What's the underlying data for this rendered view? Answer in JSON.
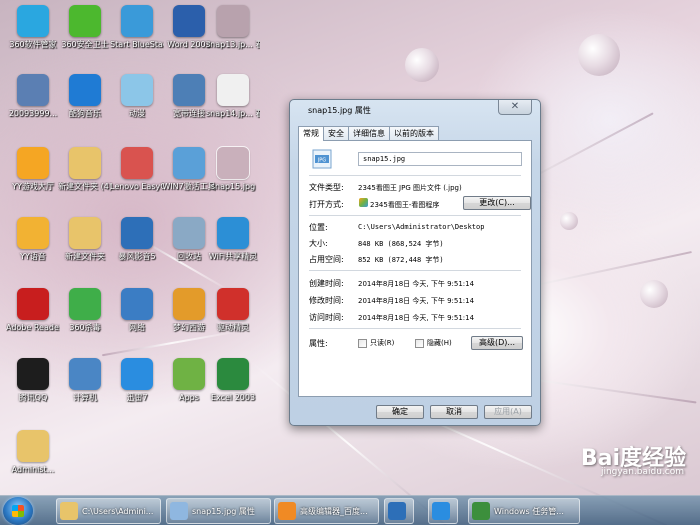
{
  "desktop": {
    "icons": [
      {
        "label": "360软件管家",
        "icon": "360-software-manager-icon",
        "color": "#2aa7e0"
      },
      {
        "label": "360安全卫士",
        "icon": "360-security-icon",
        "color": "#4cb82e"
      },
      {
        "label": "Start BlueStacks",
        "icon": "bluestacks-icon",
        "color": "#3a9ad9"
      },
      {
        "label": "Word 2003",
        "icon": "word-icon",
        "color": "#2b5fab"
      },
      {
        "label": "snap13.jp... 看图王.jpg",
        "icon": "image-file-icon",
        "color": "#b8a2ad"
      },
      {
        "label": "20093999...",
        "icon": "keyboard-icon",
        "color": "#5b7fb3"
      },
      {
        "label": "酷狗音乐",
        "icon": "kugou-icon",
        "color": "#1f7bd4"
      },
      {
        "label": "动漫",
        "icon": "cartoon-icon",
        "color": "#8cc6e8"
      },
      {
        "label": "宽带连接",
        "icon": "broadband-icon",
        "color": "#4d7fb6"
      },
      {
        "label": "snap14.jp... 看图王.jpg",
        "icon": "image-file-icon",
        "color": "#f0f0f0"
      },
      {
        "label": "YY游戏大厅",
        "icon": "yy-game-icon",
        "color": "#f5a623"
      },
      {
        "label": "新建文件夹 (4)",
        "icon": "folder-icon",
        "color": "#e8c46a"
      },
      {
        "label": "Lenovo EasyCapt...",
        "icon": "camera-icon",
        "color": "#d9534f"
      },
      {
        "label": "WIN7激活工具",
        "icon": "win7-icon",
        "color": "#5aa0d8"
      },
      {
        "label": "snap15.jpg",
        "icon": "image-file-icon",
        "color": "#c9b0bb"
      },
      {
        "label": "YY语音",
        "icon": "yy-voice-icon",
        "color": "#f2b233"
      },
      {
        "label": "新建文件夹",
        "icon": "folder-icon",
        "color": "#e8c46a"
      },
      {
        "label": "暴风影音5",
        "icon": "storm-player-icon",
        "color": "#2d6fb8"
      },
      {
        "label": "回收站",
        "icon": "recycle-bin-icon",
        "color": "#8aa9c5"
      },
      {
        "label": "WiFi共享精灵",
        "icon": "wifi-icon",
        "color": "#2c8fd6"
      },
      {
        "label": "Adobe Reader XI",
        "icon": "adobe-reader-icon",
        "color": "#c81e1e"
      },
      {
        "label": "360杀毒",
        "icon": "360-antivirus-icon",
        "color": "#3fae49"
      },
      {
        "label": "网络",
        "icon": "network-icon",
        "color": "#3b7dc4"
      },
      {
        "label": "梦幻西游",
        "icon": "game-icon",
        "color": "#e39b2a"
      },
      {
        "label": "驱动精灵",
        "icon": "driver-icon",
        "color": "#d0302b"
      },
      {
        "label": "腾讯QQ",
        "icon": "qq-icon",
        "color": "#1d1d1d"
      },
      {
        "label": "计算机",
        "icon": "computer-icon",
        "color": "#4a86c5"
      },
      {
        "label": "迅雷7",
        "icon": "thunder-icon",
        "color": "#2a8de0"
      },
      {
        "label": "Apps",
        "icon": "apps-icon",
        "color": "#6fb244"
      },
      {
        "label": "Excel 2003",
        "icon": "excel-icon",
        "color": "#2b8a3e"
      },
      {
        "label": "Administ...",
        "icon": "user-folder-icon",
        "color": "#e8c46a"
      }
    ]
  },
  "dialog": {
    "title": "snap15.jpg 属性",
    "close_symbol": "✕",
    "tabs": [
      "常规",
      "安全",
      "详细信息",
      "以前的版本"
    ],
    "filename": "snap15.jpg",
    "file_type_label": "文件类型:",
    "file_type_value": "2345看图王 JPG 图片文件 (.jpg)",
    "open_with_label": "打开方式:",
    "open_with_value": "2345看图王-看图程序",
    "change_button": "更改(C)...",
    "location_label": "位置:",
    "location_value": "C:\\Users\\Administrator\\Desktop",
    "size_label": "大小:",
    "size_value": "848 KB (868,524 字节)",
    "disk_size_label": "占用空间:",
    "disk_size_value": "852 KB (872,448 字节)",
    "created_label": "创建时间:",
    "created_value": "2014年8月18日 今天, 下午 9:51:14",
    "modified_label": "修改时间:",
    "modified_value": "2014年8月18日 今天, 下午 9:51:14",
    "accessed_label": "访问时间:",
    "accessed_value": "2014年8月18日 今天, 下午 9:51:14",
    "attributes_label": "属性:",
    "readonly_label": "只读(R)",
    "hidden_label": "隐藏(H)",
    "advanced_button": "高级(D)...",
    "ok_button": "确定",
    "cancel_button": "取消",
    "apply_button": "应用(A)"
  },
  "taskbar": {
    "items": [
      {
        "label": "C:\\Users\\Admini...",
        "icon": "explorer-folder-icon",
        "color": "#e8c46a"
      },
      {
        "label": "snap15.jpg 属性",
        "icon": "properties-icon",
        "color": "#8fb7e0"
      },
      {
        "label": "高级编辑器_百度...",
        "icon": "browser-icon",
        "color": "#f08a24"
      },
      {
        "label": "",
        "icon": "storm-player-icon",
        "color": "#2d6fb8"
      },
      {
        "label": "",
        "icon": "thunder-icon",
        "color": "#2a8de0"
      },
      {
        "label": "Windows 任务管...",
        "icon": "task-manager-icon",
        "color": "#3c8f3c"
      }
    ]
  },
  "watermark": {
    "brand": "Bai度经验",
    "url": "jingyan.baidu.com"
  }
}
